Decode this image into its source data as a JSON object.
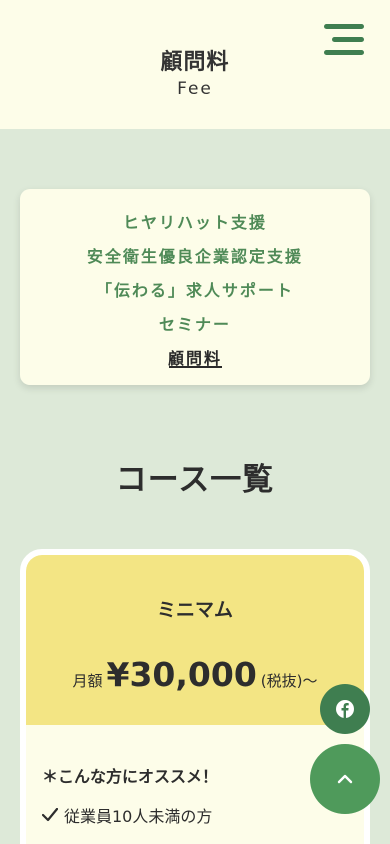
{
  "header": {
    "title": "顧問料",
    "subtitle": "Fee",
    "menu_icon": "hamburger-menu-icon"
  },
  "nav": {
    "items": [
      {
        "label": "ヒヤリハット支援"
      },
      {
        "label": "安全衛生優良企業認定支援"
      },
      {
        "label": "「伝わる」求人サポート"
      },
      {
        "label": "セミナー"
      },
      {
        "label": "顧問料",
        "active": true
      }
    ]
  },
  "courses": {
    "title": "コース一覧",
    "card": {
      "name": "ミニマム",
      "price_prefix": "月額",
      "price": "¥30,000",
      "price_suffix": "(税抜)〜",
      "recommend_title": "＊こんな方にオススメ！",
      "checks": [
        "従業員10人未満の方"
      ]
    }
  },
  "floating": {
    "facebook_icon": "facebook-icon",
    "back_to_top_icon": "chevron-up-icon"
  },
  "colors": {
    "header_bg": "#fdfde9",
    "page_bg": "#dde9d8",
    "accent_green": "#3f7e50",
    "nav_text": "#4f8a57",
    "card_top": "#f3e584"
  }
}
